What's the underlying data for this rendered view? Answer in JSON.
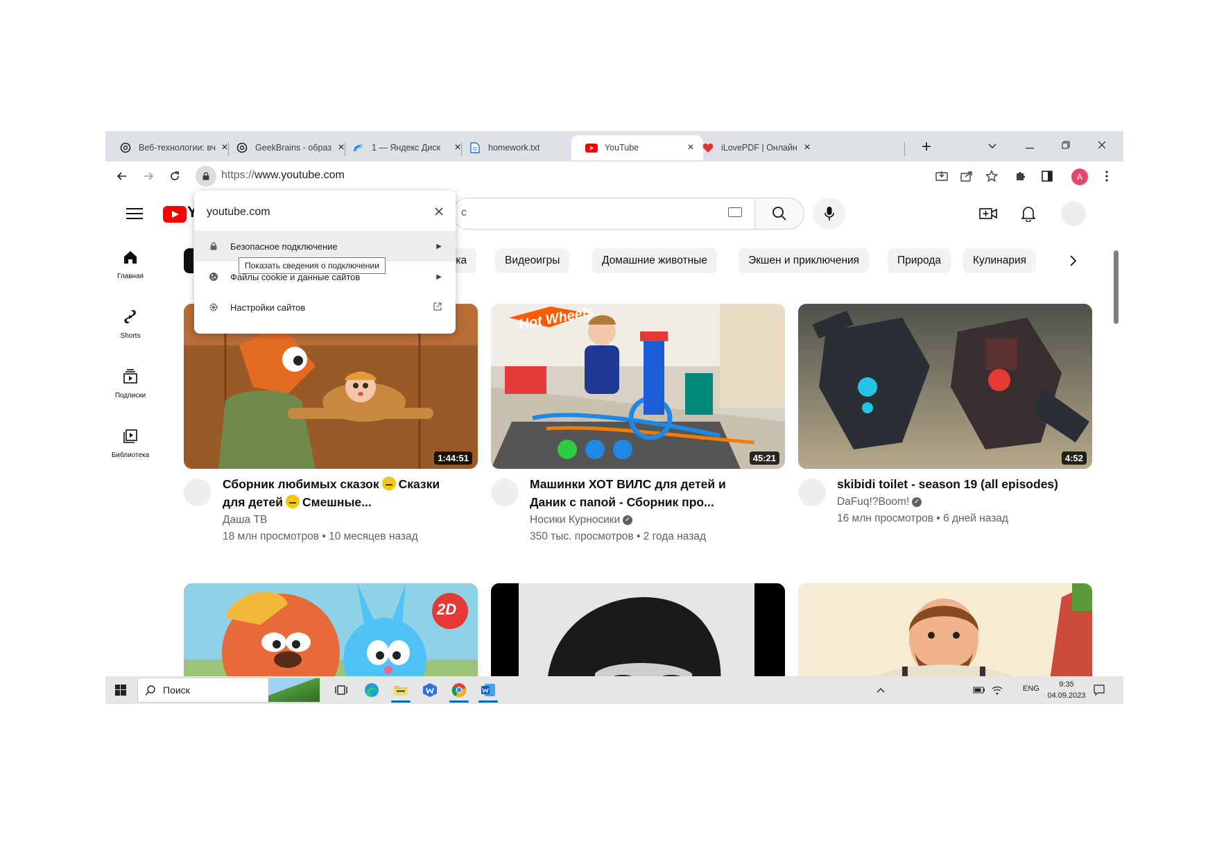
{
  "browser": {
    "tabs": [
      {
        "title": "Веб-технологии: вч",
        "icon": "openai-icon"
      },
      {
        "title": "GeekBrains - образ",
        "icon": "openai-icon"
      },
      {
        "title": "1 — Яндекс Диск",
        "icon": "yandex-disk-icon"
      },
      {
        "title": "homework.txt",
        "icon": "document-icon"
      },
      {
        "title": "YouTube",
        "icon": "youtube-icon",
        "active": true
      },
      {
        "title": "iLovePDF | Онлайн",
        "icon": "ilovepdf-icon"
      }
    ],
    "url_scheme": "https://",
    "url_host": "www.youtube.com",
    "profile_initial": "A"
  },
  "site_info_popup": {
    "domain": "youtube.com",
    "rows": [
      {
        "label": "Безопасное подключение",
        "icon": "lock-icon"
      },
      {
        "label": "Файлы cookie и данные сайтов",
        "icon": "cookie-icon"
      },
      {
        "label": "Настройки сайтов",
        "icon": "gear-icon"
      }
    ],
    "tooltip": "Показать сведения о подключении"
  },
  "youtube": {
    "logo_letter": "Y",
    "search_partial": "c",
    "sidebar": [
      {
        "label": "Главная",
        "icon": "home-icon"
      },
      {
        "label": "Shorts",
        "icon": "shorts-icon"
      },
      {
        "label": "Подписки",
        "icon": "subscriptions-icon"
      },
      {
        "label": "Библиотека",
        "icon": "library-icon"
      }
    ],
    "chips": [
      "зыка",
      "Видеоигры",
      "Домашние животные",
      "Экшен и приключения",
      "Природа",
      "Кулинария"
    ],
    "videos": [
      {
        "title_line1": "Сборник любимых сказок",
        "title_mid": "Сказки",
        "title_line2a": "для детей",
        "title_line2b": "Смешные...",
        "channel": "Даша ТВ",
        "verified": false,
        "views": "18 млн просмотров",
        "age": "10 месяцев назад",
        "duration": "1:44:51"
      },
      {
        "title_line1": "Машинки ХОТ ВИЛС для детей и",
        "title_line2": "Даник с папой - Сборник про...",
        "channel": "Носики Курносики",
        "verified": true,
        "views": "350 тыс. просмотров",
        "age": "2 года назад",
        "duration": "45:21"
      },
      {
        "title_line1": "skibidi toilet - season 19 (all episodes)",
        "channel": "DaFuq!?Boom!",
        "verified": true,
        "views": "16 млн просмотров",
        "age": "6 дней назад",
        "duration": "4:52"
      }
    ],
    "meta_separator": "•",
    "thumb_badge": "2D",
    "thumb_logo": "Hot Wheels"
  },
  "taskbar": {
    "search_label": "Поиск",
    "lang": "ENG",
    "time": "9:35",
    "date": "04.09.2023"
  },
  "colors": {
    "youtube_red": "#ff0000",
    "tab_strip": "#dee1e6",
    "chip_bg": "#f2f2f2",
    "profile": "#e8466e"
  }
}
